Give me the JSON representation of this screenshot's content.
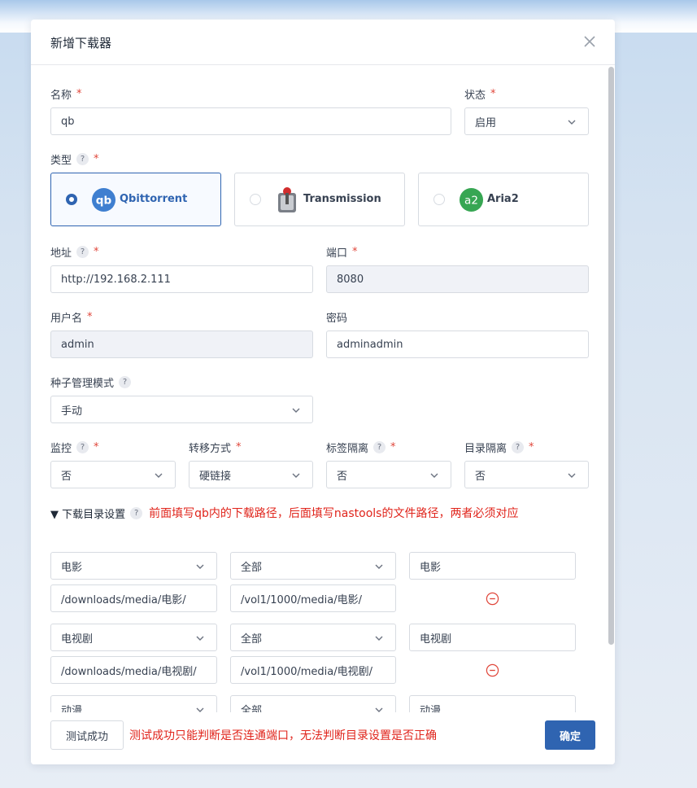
{
  "dialog": {
    "title": "新增下载器"
  },
  "form": {
    "name": {
      "label": "名称",
      "required": "*",
      "value": "qb"
    },
    "status": {
      "label": "状态",
      "required": "*",
      "value": "启用"
    },
    "type": {
      "label": "类型",
      "help": "?",
      "required": "*",
      "options": [
        {
          "name": "Qbittorrent",
          "icon": "qb-logo-icon",
          "selected": true
        },
        {
          "name": "Transmission",
          "icon": "transmission-logo-icon",
          "selected": false
        },
        {
          "name": "Aria2",
          "icon": "aria2-logo-icon",
          "selected": false
        }
      ]
    },
    "address": {
      "label": "地址",
      "help": "?",
      "required": "*",
      "value": "http://192.168.2.111"
    },
    "port": {
      "label": "端口",
      "required": "*",
      "value": "8080"
    },
    "username": {
      "label": "用户名",
      "required": "*",
      "value": "admin"
    },
    "password": {
      "label": "密码",
      "value": "adminadmin"
    },
    "torrent_mode": {
      "label": "种子管理模式",
      "help": "?",
      "value": "手动"
    },
    "monitor": {
      "label": "监控",
      "help": "?",
      "required": "*",
      "value": "否"
    },
    "transfer": {
      "label": "转移方式",
      "required": "*",
      "value": "硬链接"
    },
    "tag_isolation": {
      "label": "标签隔离",
      "help": "?",
      "required": "*",
      "value": "否"
    },
    "dir_isolation": {
      "label": "目录隔离",
      "help": "?",
      "required": "*",
      "value": "否"
    },
    "download_dirs": {
      "label": "▼ 下载目录设置",
      "help": "?",
      "hint": "前面填写qb内的下载路径，后面填写nastools的文件路径，两者必须对应",
      "rows": [
        {
          "type": "电影",
          "scope": "全部",
          "label": "电影",
          "download_path": "/downloads/media/电影/",
          "local_path": "/vol1/1000/media/电影/"
        },
        {
          "type": "电视剧",
          "scope": "全部",
          "label": "电视剧",
          "download_path": "/downloads/media/电视剧/",
          "local_path": "/vol1/1000/media/电视剧/"
        },
        {
          "type": "动漫",
          "scope": "全部",
          "label": "动漫",
          "download_path": "",
          "local_path": ""
        }
      ]
    }
  },
  "footer": {
    "test_button": "测试成功",
    "test_hint": "测试成功只能判断是否连通端口，无法判断目录设置是否正确",
    "confirm_button": "确定"
  },
  "colors": {
    "primary": "#2f64b1",
    "required": "#e0463a",
    "hint": "#e0241b",
    "readonly_bg": "#f0f2f7"
  }
}
